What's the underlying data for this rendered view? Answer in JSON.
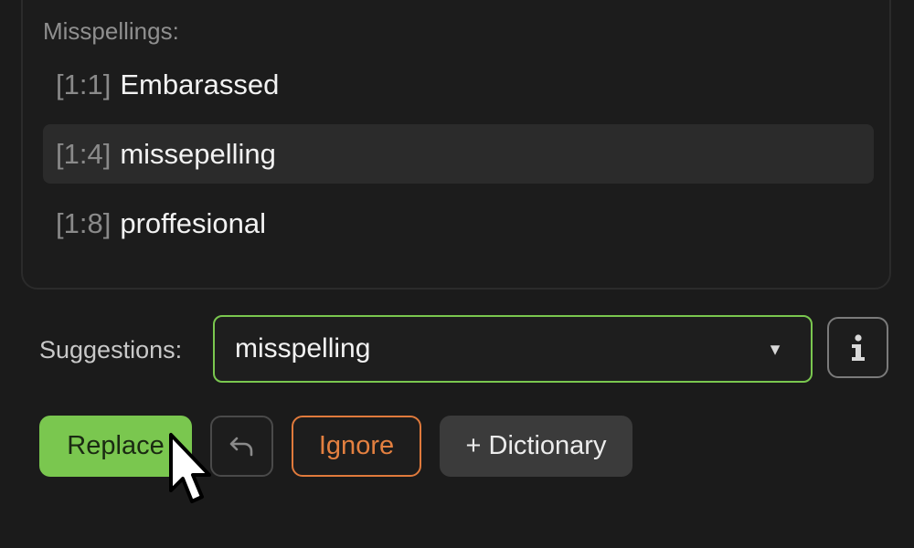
{
  "misspellings": {
    "label": "Misspellings:",
    "items": [
      {
        "location": "[1:1]",
        "word": "Embarassed",
        "selected": false
      },
      {
        "location": "[1:4]",
        "word": "missepelling",
        "selected": true
      },
      {
        "location": "[1:8]",
        "word": "proffesional",
        "selected": false
      }
    ]
  },
  "suggestions": {
    "label": "Suggestions:",
    "selected_value": "misspelling",
    "dropdown_icon": "triangle-down-icon",
    "accent_color": "#7ac74f"
  },
  "info_button": {
    "icon": "info-icon"
  },
  "actions": {
    "replace_label": "Replace",
    "undo_icon": "undo-arrow-icon",
    "ignore_label": "Ignore",
    "dictionary_label": "+ Dictionary"
  },
  "colors": {
    "background": "#1b1b1b",
    "replace": "#7ac74f",
    "ignore": "#e07a3c",
    "selected_row": "#2b2b2b"
  }
}
